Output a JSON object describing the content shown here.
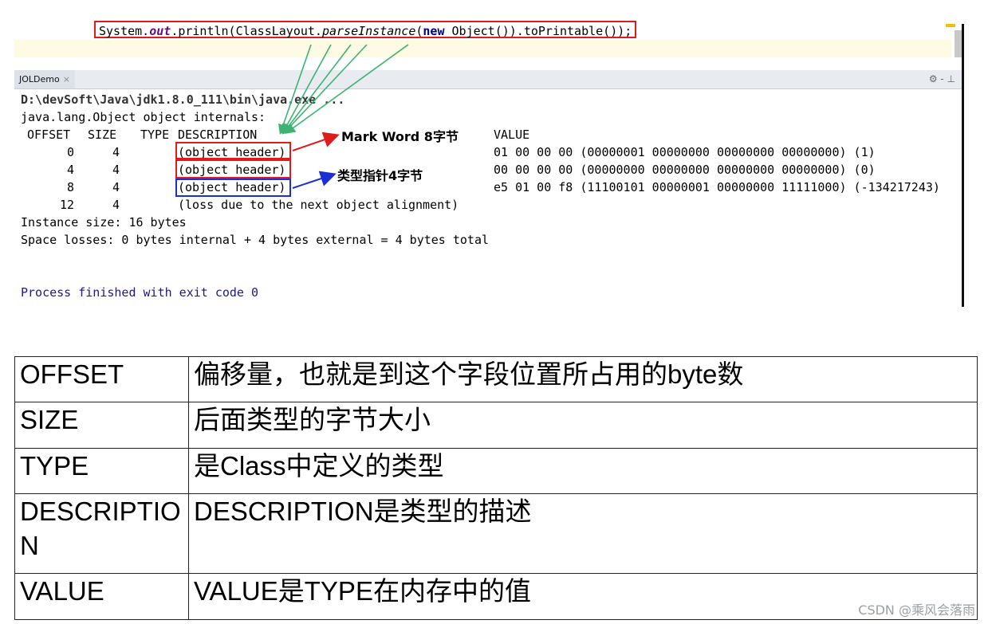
{
  "editor": {
    "code": {
      "p1": "System.",
      "p2": "out",
      "p3": ".println(ClassLayout.",
      "p4": "parseInstance",
      "p5": "(",
      "p6": "new",
      "p7": " Object()).toPrintable());"
    }
  },
  "run_panel": {
    "tab_label": "JOLDemo",
    "tab_close": "×",
    "tools": "⚙ - ⊥",
    "command": "D:\\devSoft\\Java\\jdk1.8.0_111\\bin\\java.exe ...",
    "header_line": "java.lang.Object object internals:",
    "columns": {
      "offset": "OFFSET",
      "size": "SIZE",
      "type": "TYPE",
      "description": "DESCRIPTION",
      "value": "VALUE"
    },
    "rows": [
      {
        "offset": "0",
        "size": "4",
        "description": "(object header)",
        "value": "01 00 00 00 (00000001 00000000 00000000 00000000) (1)"
      },
      {
        "offset": "4",
        "size": "4",
        "description": "(object header)",
        "value": "00 00 00 00 (00000000 00000000 00000000 00000000) (0)"
      },
      {
        "offset": "8",
        "size": "4",
        "description": "(object header)",
        "value": "e5 01 00 f8 (11100101 00000001 00000000 11111000) (-134217243)"
      },
      {
        "offset": "12",
        "size": "4",
        "description": "(loss due to the next object alignment)",
        "value": ""
      }
    ],
    "instance_size": "Instance size: 16 bytes",
    "space_losses": "Space losses: 0 bytes internal + 4 bytes external = 4 bytes total",
    "process": "Process finished with exit code 0"
  },
  "annotations": {
    "mark_word": "Mark Word 8字节",
    "type_pointer": "类型指针4字节",
    "colors": {
      "red": "#e01b1b",
      "blue": "#1a2fd6",
      "green": "#3cb371"
    }
  },
  "definitions": [
    {
      "term": "OFFSET",
      "desc": "偏移量，也就是到这个字段位置所占用的byte数"
    },
    {
      "term": "SIZE",
      "desc": "后面类型的字节大小"
    },
    {
      "term": "TYPE",
      "desc": "是Class中定义的类型"
    },
    {
      "term": "DESCRIPTION",
      "desc": "DESCRIPTION是类型的描述"
    },
    {
      "term": "VALUE",
      "desc": "VALUE是TYPE在内存中的值"
    }
  ],
  "watermark": "CSDN @乘风会落雨"
}
